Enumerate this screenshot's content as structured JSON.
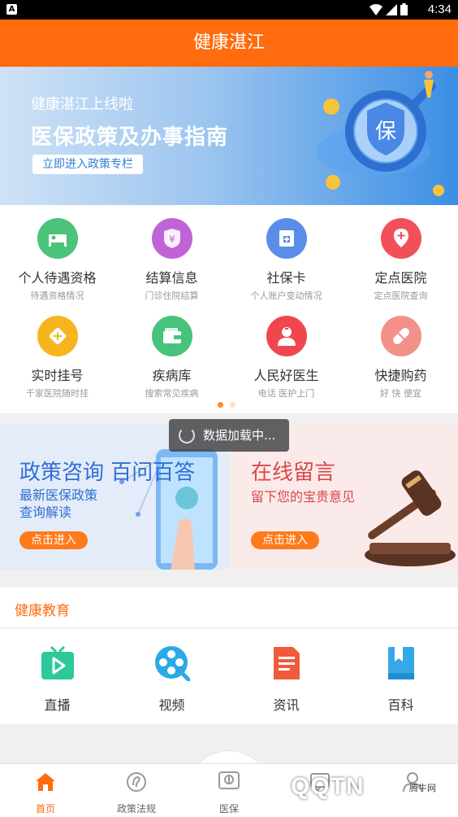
{
  "status_bar": {
    "time": "4:34"
  },
  "header": {
    "title": "健康湛江"
  },
  "banner": {
    "subtitle": "健康湛江上线啦",
    "title": "医保政策及办事指南",
    "button_label": "立即进入政策专栏",
    "shield_char": "保"
  },
  "services": [
    {
      "label": "个人待遇资格",
      "desc": "待遇资格情况",
      "icon": "bed-icon",
      "color": "#4cc37a"
    },
    {
      "label": "结算信息",
      "desc": "门诊住院结算",
      "icon": "yuan-shield-icon",
      "color": "#c063d6"
    },
    {
      "label": "社保卡",
      "desc": "个人账户变动情况",
      "icon": "card-icon",
      "color": "#5b8de8"
    },
    {
      "label": "定点医院",
      "desc": "定点医院查询",
      "icon": "location-pin-icon",
      "color": "#f1505b"
    },
    {
      "label": "实时挂号",
      "desc": "千家医院随时挂",
      "icon": "register-icon",
      "color": "#f7b51d"
    },
    {
      "label": "疾病库",
      "desc": "搜索常见疾病",
      "icon": "wallet-icon",
      "color": "#47c37a"
    },
    {
      "label": "人民好医生",
      "desc": "电话 医护上门",
      "icon": "doctor-icon",
      "color": "#f0474f"
    },
    {
      "label": "快捷购药",
      "desc": "好 快 便宜",
      "icon": "pill-icon",
      "color": "#f3908a"
    }
  ],
  "toast": {
    "text": "数据加载中..."
  },
  "promo_left": {
    "title": "政策咨询 百问百答",
    "desc_line1": "最新医保政策",
    "desc_line2": "查询解读",
    "button": "点击进入"
  },
  "promo_right": {
    "title": "在线留言",
    "desc": "留下您的宝贵意见",
    "button": "点击进入"
  },
  "education": {
    "heading": "健康教育",
    "items": [
      {
        "label": "直播",
        "icon": "tv-play-icon"
      },
      {
        "label": "视频",
        "icon": "film-reel-icon"
      },
      {
        "label": "资讯",
        "icon": "document-icon"
      },
      {
        "label": "百科",
        "icon": "bookmark-book-icon"
      }
    ]
  },
  "tabbar": {
    "items": [
      {
        "label": "首页",
        "icon": "home-icon",
        "active": true
      },
      {
        "label": "政策法规",
        "icon": "policy-icon",
        "active": false
      },
      {
        "label": "医保",
        "icon": "medical-insurance-icon",
        "active": false
      },
      {
        "label": "",
        "icon": "message-icon",
        "active": false
      },
      {
        "label": "",
        "icon": "user-icon",
        "active": false
      }
    ]
  },
  "watermark": {
    "main": "QQTN",
    "corner": "腾牛网"
  },
  "colors": {
    "primary": "#ff6b0d",
    "banner_blue": "#3b8ee5"
  }
}
